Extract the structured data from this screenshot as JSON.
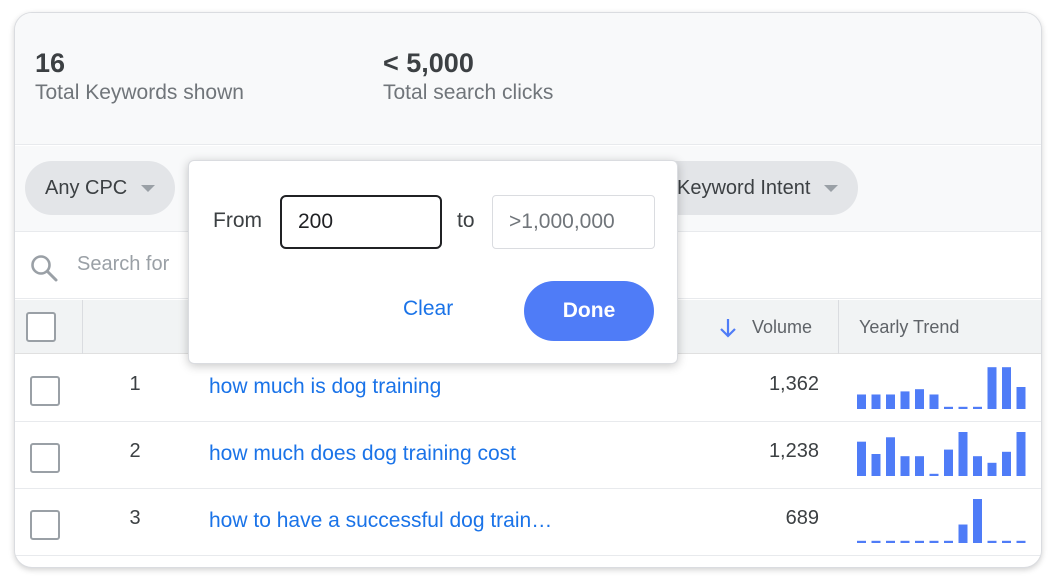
{
  "stats": {
    "keywords_value": "16",
    "keywords_label": "Total Keywords shown",
    "clicks_value": "< 5,000",
    "clicks_label": "Total search clicks"
  },
  "filters": {
    "cpc_label": "Any CPC",
    "intent_label": "Keyword Intent"
  },
  "search": {
    "placeholder": "Search for "
  },
  "table": {
    "volume_header": "Volume",
    "trend_header": "Yearly Trend",
    "rows": [
      {
        "rank": "1",
        "keyword": "how much is dog training",
        "volume": "1,362",
        "trend": [
          0.33,
          0.33,
          0.33,
          0.4,
          0.45,
          0.33,
          0.05,
          0.05,
          0.05,
          0.95,
          0.95,
          0.5
        ]
      },
      {
        "rank": "2",
        "keyword": "how much does dog training cost",
        "volume": "1,238",
        "trend": [
          0.78,
          0.5,
          0.88,
          0.45,
          0.45,
          0.05,
          0.6,
          1.0,
          0.45,
          0.3,
          0.55,
          1.0
        ]
      },
      {
        "rank": "3",
        "keyword": "how to have a successful dog train…",
        "volume": "689",
        "trend": [
          0.05,
          0.05,
          0.05,
          0.05,
          0.05,
          0.05,
          0.05,
          0.42,
          1.0,
          0.05,
          0.05,
          0.05
        ]
      }
    ]
  },
  "popup": {
    "from_label": "From",
    "from_value": "200",
    "to_label": "to",
    "to_placeholder": ">1,000,000",
    "clear_label": "Clear",
    "done_label": "Done"
  },
  "colors": {
    "link": "#1a73e8",
    "trend_bar": "#4f7cf7",
    "done_button": "#4f7cf7"
  },
  "icons": {
    "search": "search-icon",
    "sort": "arrow-down-icon",
    "dropdown": "chevron-down-icon"
  }
}
